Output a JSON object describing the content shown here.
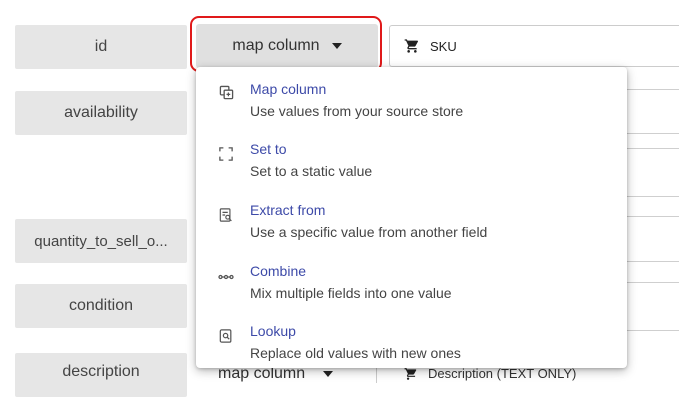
{
  "fields": [
    {
      "label": "id"
    },
    {
      "label": "availability"
    },
    {
      "label": "quantity_to_sell_o..."
    },
    {
      "label": "condition"
    },
    {
      "label": "description"
    }
  ],
  "mapping_button": {
    "label": "map column"
  },
  "sku_value": {
    "text": "SKU",
    "icon": "cart-icon"
  },
  "menu": {
    "items": [
      {
        "title": "Map column",
        "description": "Use values from your source store",
        "icon": "map-column-icon"
      },
      {
        "title": "Set to",
        "description": "Set to a static value",
        "icon": "set-to-icon"
      },
      {
        "title": "Extract from",
        "description": "Use a specific value from another field",
        "icon": "extract-icon"
      },
      {
        "title": "Combine",
        "description": "Mix multiple fields into one value",
        "icon": "combine-icon"
      },
      {
        "title": "Lookup",
        "description": "Replace old values with new ones",
        "icon": "lookup-icon"
      }
    ]
  },
  "bottom_row": {
    "button_label": "map column",
    "value_text": "Description (TEXT ONLY)"
  },
  "colors": {
    "highlight": "#e0191a",
    "menu_title": "#3d4aa8"
  }
}
